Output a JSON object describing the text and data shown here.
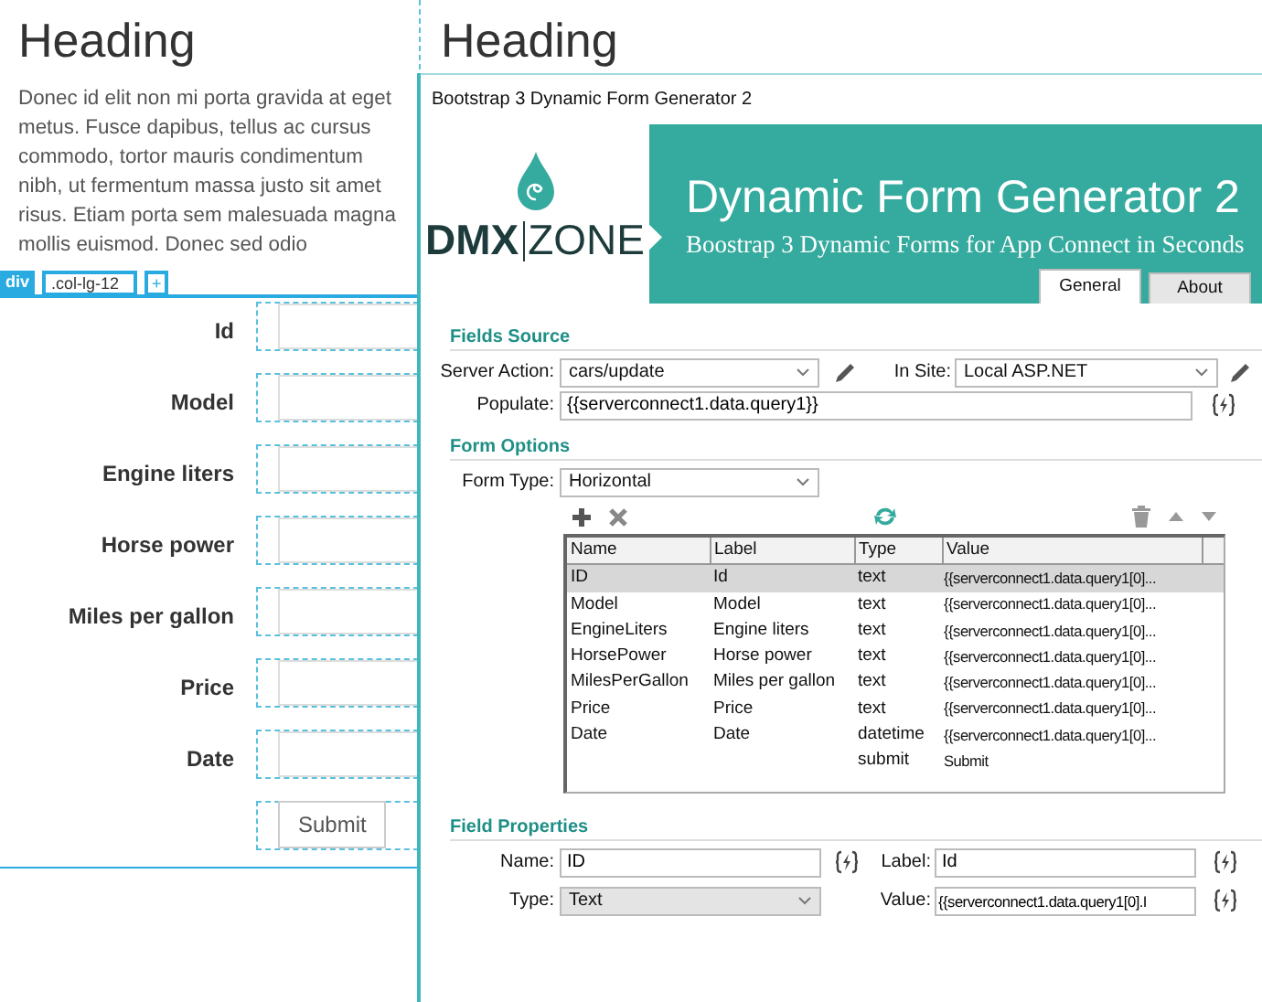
{
  "page": {
    "headings": [
      "Heading",
      "Heading"
    ],
    "paragraph": "Donec id elit non mi porta gravida at eget metus. Fusce dapibus, tellus ac cursus commodo, tortor mauris condimentum nibh, ut fermentum massa justo sit amet risus. Etiam porta sem malesuada magna mollis euismod. Donec sed odio",
    "element_tag": {
      "tag": "div",
      "class_name": ".col-lg-12",
      "add": "+"
    },
    "form": {
      "fields": [
        {
          "label": "Id"
        },
        {
          "label": "Model"
        },
        {
          "label": "Engine liters"
        },
        {
          "label": "Horse power"
        },
        {
          "label": "Miles per gallon"
        },
        {
          "label": "Price"
        },
        {
          "label": "Date"
        }
      ],
      "submit": "Submit"
    }
  },
  "dialog": {
    "title": "Bootstrap 3 Dynamic Form Generator 2",
    "banner": {
      "logo_left": "DMX",
      "logo_right": "ZONE",
      "title": "Dynamic Form Generator 2",
      "subtitle": "Boostrap 3 Dynamic Forms for App Connect in Seconds"
    },
    "tabs": [
      {
        "label": "General",
        "selected": true
      },
      {
        "label": "About",
        "selected": false
      }
    ],
    "fields_source": {
      "heading": "Fields Source",
      "server_action": {
        "label": "Server Action:",
        "value": "cars/update",
        "disabled": false
      },
      "in_site": {
        "label": "In Site:",
        "value": "Local ASP.NET",
        "disabled": false
      },
      "populate": {
        "label": "Populate:",
        "value": "{{serverconnect1.data.query1}}"
      }
    },
    "form_options": {
      "heading": "Form Options",
      "form_type": {
        "label": "Form Type:",
        "value": "Horizontal",
        "disabled": false
      },
      "table": {
        "columns": [
          "Name",
          "Label",
          "Type",
          "Value"
        ],
        "rows": [
          {
            "name": "ID",
            "label": "Id",
            "type": "text",
            "value": "{{serverconnect1.data.query1[0]...",
            "selected": true
          },
          {
            "name": "Model",
            "label": "Model",
            "type": "text",
            "value": "{{serverconnect1.data.query1[0]...",
            "selected": false
          },
          {
            "name": "EngineLiters",
            "label": "Engine liters",
            "type": "text",
            "value": "{{serverconnect1.data.query1[0]...",
            "selected": false
          },
          {
            "name": "HorsePower",
            "label": "Horse power",
            "type": "text",
            "value": "{{serverconnect1.data.query1[0]...",
            "selected": false
          },
          {
            "name": "MilesPerGallon",
            "label": "Miles per gallon",
            "type": "text",
            "value": "{{serverconnect1.data.query1[0]...",
            "selected": false
          },
          {
            "name": "Price",
            "label": "Price",
            "type": "text",
            "value": "{{serverconnect1.data.query1[0]...",
            "selected": false
          },
          {
            "name": "Date",
            "label": "Date",
            "type": "datetime",
            "value": "{{serverconnect1.data.query1[0]...",
            "selected": false
          },
          {
            "name": "",
            "label": "",
            "type": "submit",
            "value": "Submit",
            "selected": false
          }
        ]
      }
    },
    "field_properties": {
      "heading": "Field Properties",
      "name": {
        "label": "Name:",
        "value": "ID"
      },
      "label": {
        "label": "Label:",
        "value": "Id"
      },
      "type": {
        "label": "Type:",
        "value": "Text",
        "disabled": true
      },
      "value": {
        "label": "Value:",
        "value": "{{serverconnect1.data.query1[0].I"
      }
    }
  }
}
